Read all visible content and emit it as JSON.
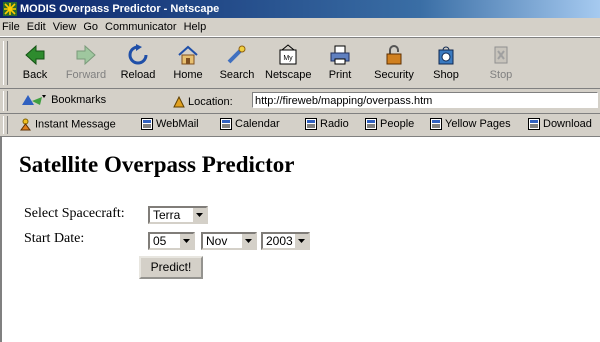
{
  "window": {
    "title": "MODIS Overpass Predictor - Netscape"
  },
  "menu": [
    "File",
    "Edit",
    "View",
    "Go",
    "Communicator",
    "Help"
  ],
  "toolbar": {
    "back": "Back",
    "forward": "Forward",
    "reload": "Reload",
    "home": "Home",
    "search": "Search",
    "netscape": "Netscape",
    "print": "Print",
    "security": "Security",
    "shop": "Shop",
    "stop": "Stop"
  },
  "location_bar": {
    "bookmarks": "Bookmarks",
    "location_label": "Location:",
    "url": "http://fireweb/mapping/overpass.htm"
  },
  "personal_bar": {
    "instant_message": "Instant Message",
    "webmail": "WebMail",
    "calendar": "Calendar",
    "radio": "Radio",
    "people": "People",
    "yellow_pages": "Yellow Pages",
    "download": "Download"
  },
  "page": {
    "heading": "Satellite Overpass Predictor",
    "spacecraft_label": "Select Spacecraft:",
    "spacecraft_value": "Terra",
    "start_date_label": "Start Date:",
    "day_value": "05",
    "month_value": "Nov",
    "year_value": "2003",
    "predict_button": "Predict!"
  },
  "colors": {
    "title_bar": "#0a246a",
    "chrome": "#d4d0c8"
  }
}
